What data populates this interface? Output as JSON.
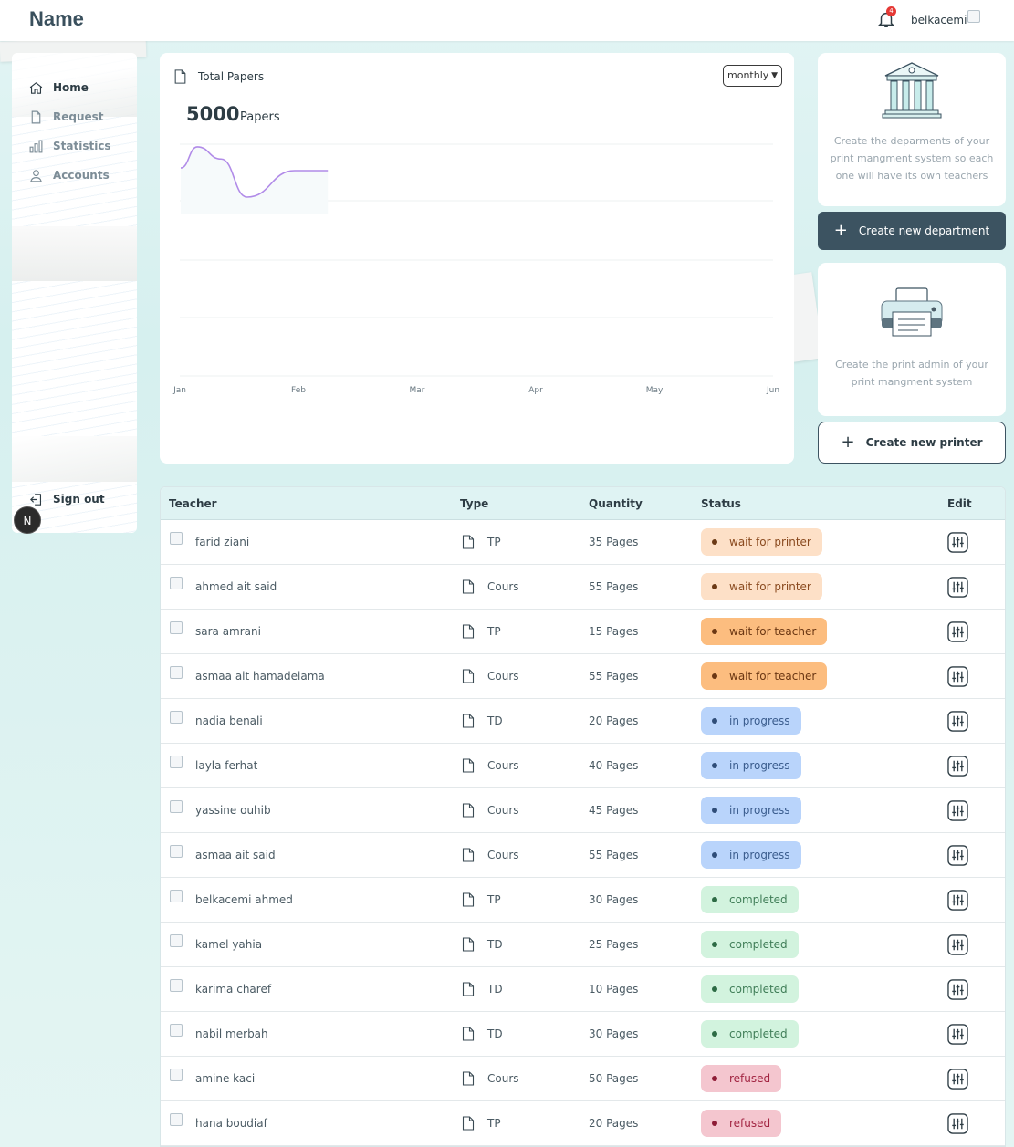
{
  "header": {
    "app_title": "Name",
    "notifications_count": "4",
    "username": "belkacemi"
  },
  "sidebar": {
    "items": [
      {
        "label": "Home",
        "icon": "home-icon",
        "active": true
      },
      {
        "label": "Request",
        "icon": "file-icon",
        "active": false
      },
      {
        "label": "Statistics",
        "icon": "bar-chart-icon",
        "active": false
      },
      {
        "label": "Accounts",
        "icon": "user-icon",
        "active": false
      }
    ],
    "signout_label": "Sign out",
    "badge_letter": "N"
  },
  "papers_card": {
    "title": "Total Papers",
    "period_select": "monthly",
    "total_value": "5000",
    "total_unit": "Papers"
  },
  "chart_data": {
    "type": "line",
    "x": [
      "Jan",
      "Feb",
      "Mar",
      "Apr",
      "May",
      "Jun"
    ],
    "series": [
      {
        "values": [
          [
            0,
            0.55
          ],
          [
            0.07,
            0.95
          ],
          [
            0.17,
            0.72
          ],
          [
            0.28,
            0.0
          ],
          [
            0.48,
            0.5
          ],
          [
            0.62,
            0.5
          ]
        ]
      }
    ],
    "grid": true,
    "color": "#b18be8"
  },
  "department_card": {
    "icon": "bank-building-icon",
    "text": "Create the deparments of your print mangment system so each one will have its own teachers",
    "button_label": "Create new department"
  },
  "printer_card": {
    "icon": "printer-icon",
    "text": "Create the print admin of your print mangment system",
    "button_label": "Create new printer"
  },
  "table": {
    "columns": [
      "Teacher",
      "Type",
      "Quantity",
      "Status",
      "Edit"
    ],
    "rows": [
      {
        "teacher": "farid ziani",
        "type": "TP",
        "quantity": "35 Pages",
        "status": "wait for printer",
        "kind": "wait-printer"
      },
      {
        "teacher": "ahmed ait said",
        "type": "Cours",
        "quantity": "55 Pages",
        "status": "wait for printer",
        "kind": "wait-printer"
      },
      {
        "teacher": "sara amrani",
        "type": "TP",
        "quantity": "15 Pages",
        "status": "wait for teacher",
        "kind": "wait-teacher"
      },
      {
        "teacher": "asmaa ait hamadeiama",
        "type": "Cours",
        "quantity": "55 Pages",
        "status": "wait for teacher",
        "kind": "wait-teacher"
      },
      {
        "teacher": "nadia benali",
        "type": "TD",
        "quantity": "20 Pages",
        "status": "in progress",
        "kind": "progress"
      },
      {
        "teacher": "layla ferhat",
        "type": "Cours",
        "quantity": "40 Pages",
        "status": "in progress",
        "kind": "progress"
      },
      {
        "teacher": "yassine ouhib",
        "type": "Cours",
        "quantity": "45 Pages",
        "status": "in progress",
        "kind": "progress"
      },
      {
        "teacher": "asmaa ait said",
        "type": "Cours",
        "quantity": "55 Pages",
        "status": "in progress",
        "kind": "progress"
      },
      {
        "teacher": "belkacemi ahmed",
        "type": "TP",
        "quantity": "30 Pages",
        "status": "completed",
        "kind": "done"
      },
      {
        "teacher": "kamel yahia",
        "type": "TD",
        "quantity": "25 Pages",
        "status": "completed",
        "kind": "done"
      },
      {
        "teacher": "karima charef",
        "type": "TD",
        "quantity": "10 Pages",
        "status": "completed",
        "kind": "done"
      },
      {
        "teacher": "nabil merbah",
        "type": "TD",
        "quantity": "30 Pages",
        "status": "completed",
        "kind": "done"
      },
      {
        "teacher": "amine kaci",
        "type": "Cours",
        "quantity": "50 Pages",
        "status": "refused",
        "kind": "refused"
      },
      {
        "teacher": "hana boudiaf",
        "type": "TP",
        "quantity": "20 Pages",
        "status": "refused",
        "kind": "refused"
      }
    ]
  }
}
